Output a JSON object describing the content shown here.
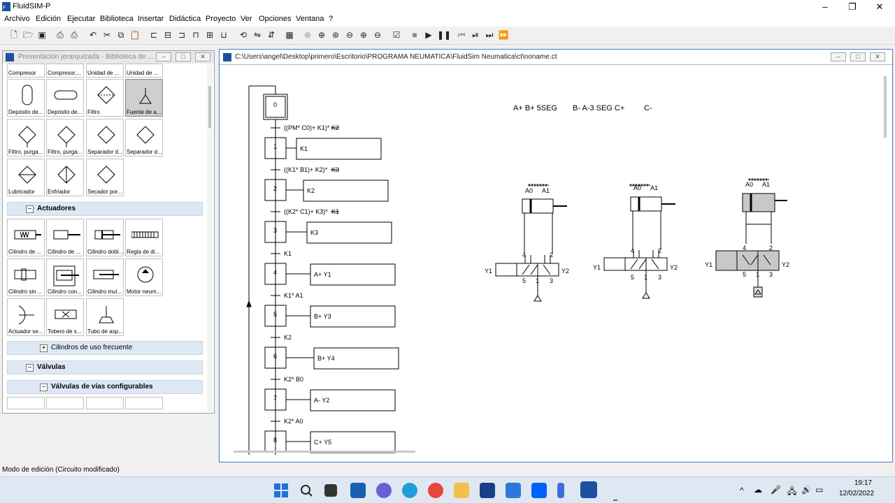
{
  "app": {
    "title": "FluidSIM-P"
  },
  "menu": [
    "Archivo",
    "Edición",
    "Ejecutar",
    "Biblioteca",
    "Insertar",
    "Didáctica",
    "Proyecto",
    "Ver",
    "Opciones",
    "Ventana",
    "?"
  ],
  "library": {
    "title": "Presentación jerarquizada - Biblioteca de ...",
    "top_row": [
      "Compresor",
      "Compresor,...",
      "Unidad de ...",
      "Unidad de ..."
    ],
    "tiles_row1": [
      "Depósito de...",
      "Depósito de...",
      "Filtro",
      "Fuente de a..."
    ],
    "tiles_row2": [
      "Filtro, purga...",
      "Filtro, purga...",
      "Separador d...",
      "Separador d..."
    ],
    "tiles_row3": [
      "Lubricador",
      "Enfriador",
      "Secador por..."
    ],
    "cat_actuadores": "Actuadores",
    "act_row1": [
      "Cilindro de ...",
      "Cilindro de ...",
      "Cilindro dobl...",
      "Regla de di..."
    ],
    "act_row2": [
      "Cilindro sin ...",
      "Cilindro con...",
      "Cilindro mul...",
      "Motor neum..."
    ],
    "act_row3": [
      "Actuador se...",
      "Tobero de s...",
      "Tubo de asp..."
    ],
    "cat_cilindros": "Cilindros de uso frecuente",
    "cat_valvulas": "Válvulas",
    "cat_vias": "Válvulas de vías configurables"
  },
  "document": {
    "title": "C:\\Users\\angel\\Desktop\\primero\\Escritorio\\PROGRAMA NEUMATICA\\FluidSim Neumatica\\ct\\noname.ct",
    "sequence_a": "A+ B+ 5SEG",
    "sequence_b": "B- A-3 SEG C+",
    "sequence_c": "C-",
    "grafcet": {
      "steps": [
        "0",
        "1",
        "2",
        "3",
        "4",
        "5",
        "6",
        "7",
        "8"
      ],
      "actions": [
        "K1",
        "K2",
        "K3",
        "A+ Y1",
        "B+ Y3",
        "B+ Y4",
        "A- Y2",
        "C+ Y5"
      ],
      "transitions": [
        "((PM* C0)+ K1)*",
        "K2",
        "((K1* B1)+ K2)*",
        "K3",
        "((K2* C1)+ K3)*",
        "K1",
        "K1",
        "K1* A1",
        "K2",
        "K2* B0",
        "K2* A0"
      ]
    },
    "cylinders": [
      {
        "left": "A0",
        "right": "A1"
      },
      {
        "left": "A0",
        "right": "A1"
      },
      {
        "left": "A0",
        "right": "A1"
      }
    ],
    "valves": [
      {
        "sol_left": "Y1",
        "sol_right": "Y2",
        "p4": "4",
        "p2": "2",
        "p5": "5",
        "p1": "1",
        "p3": "3"
      },
      {
        "sol_left": "Y1",
        "sol_right": "Y2",
        "p4": "4",
        "p2": "2",
        "p5": "5",
        "p1": "1",
        "p3": "3"
      },
      {
        "sol_left": "Y1",
        "sol_right": "Y2",
        "p4": "4",
        "p2": "2",
        "p5": "5",
        "p1": "1",
        "p3": "3"
      }
    ]
  },
  "status": "Modo de edición (Circuito modificado)",
  "clock": {
    "time": "19:17",
    "date": "12/02/2022"
  }
}
